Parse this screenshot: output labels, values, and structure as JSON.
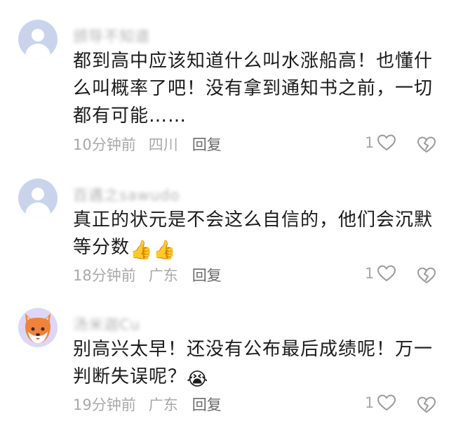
{
  "comments": [
    {
      "username": "颁导不知道",
      "text_lines": [
        "都到高中应该知道什么叫水涨船高！也懂什",
        "么叫概率了吧！没有拿到通知书之前，一切",
        "都有可能……"
      ],
      "time": "10分钟前",
      "location": "四川",
      "reply_label": "回复",
      "likes": "1",
      "avatar": "default-avatar-icon"
    },
    {
      "username": "百遇之sawudo",
      "text_lines": [
        "真正的状元是不会这么自信的，他们会沉默",
        "等分数"
      ],
      "emoji": "👍👍",
      "time": "18分钟前",
      "location": "广东",
      "reply_label": "回复",
      "likes": "1",
      "avatar": "default-avatar-icon"
    },
    {
      "username": "汤米迦Cu",
      "text_lines": [
        "别高兴太早！还没有公布最后成绩呢！万一",
        "判断失误呢？"
      ],
      "emoji": "😭",
      "time": "19分钟前",
      "location": "广东",
      "reply_label": "回复",
      "likes": "1",
      "avatar": "fox-avatar-icon"
    }
  ],
  "colors": {
    "text": "#1b1b1b",
    "meta": "#a8a8a8",
    "avatar_default_bg": "#c9d4ec",
    "fox_orange": "#f0833c"
  }
}
